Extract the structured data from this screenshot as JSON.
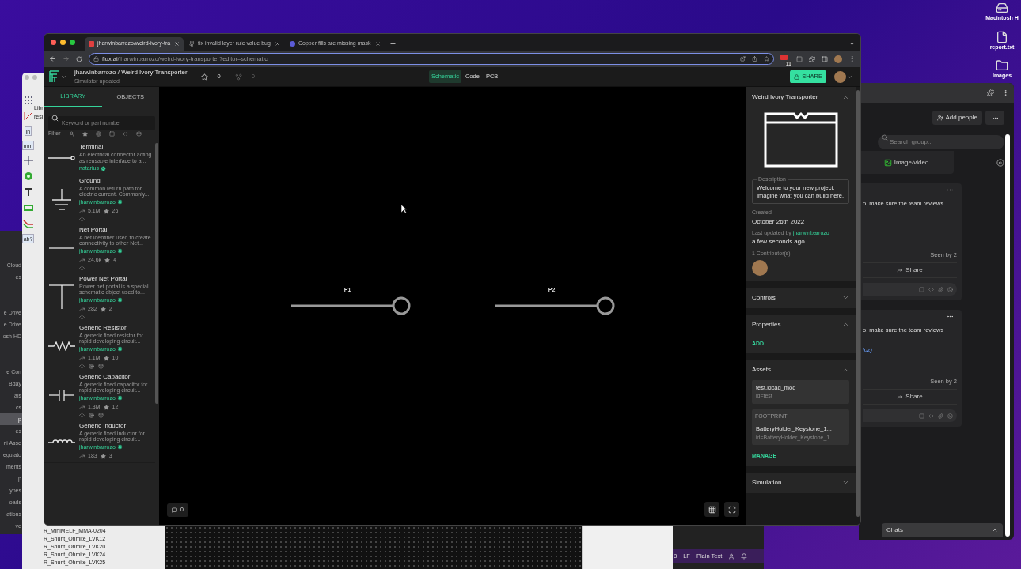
{
  "desktop": {
    "icons": [
      {
        "kind": "drive",
        "label": "Macintosh H"
      },
      {
        "kind": "file",
        "label": "report.txt"
      },
      {
        "kind": "folder",
        "label": "Images"
      }
    ]
  },
  "finder": {
    "groups": [
      [
        {
          "label": "Cloud",
          "selected": false
        },
        {
          "label": "es",
          "selected": false
        }
      ],
      [
        {
          "label": "e Drive",
          "selected": false
        },
        {
          "label": "e Drive",
          "selected": false
        },
        {
          "label": "osh HD",
          "selected": false
        }
      ],
      [
        {
          "label": "e Con",
          "selected": false
        },
        {
          "label": "Bday",
          "selected": false
        },
        {
          "label": "als",
          "selected": false
        },
        {
          "label": "cs",
          "selected": false
        },
        {
          "label": "p",
          "selected": true
        },
        {
          "label": "es",
          "selected": false
        },
        {
          "label": "ni Asse",
          "selected": false
        },
        {
          "label": "egulato",
          "selected": false
        },
        {
          "label": "ments",
          "selected": false
        },
        {
          "label": "p",
          "selected": false
        },
        {
          "label": "ypes",
          "selected": false
        },
        {
          "label": "oads",
          "selected": false
        },
        {
          "label": "ations",
          "selected": false
        },
        {
          "label": "ve",
          "selected": false
        }
      ]
    ]
  },
  "kicad": {
    "tab_fragment": "Libr",
    "search_fragment": "resi",
    "tools": [
      {
        "kind": "grid"
      },
      {
        "kind": "polar"
      },
      {
        "kind": "unit",
        "label": "in"
      },
      {
        "kind": "unit",
        "label": "mm"
      },
      {
        "kind": "cursor"
      },
      {
        "kind": "circle"
      },
      {
        "kind": "text"
      },
      {
        "kind": "chip"
      },
      {
        "kind": "route"
      },
      {
        "kind": "unit",
        "label": "ab?"
      }
    ],
    "footprints": [
      "R_MiniMELF_MMA-0204",
      "R_Shunt_Ohmite_LVK12",
      "R_Shunt_Ohmite_LVK20",
      "R_Shunt_Ohmite_LVK24",
      "R_Shunt_Ohmite_LVK25"
    ]
  },
  "browser": {
    "tabs": [
      {
        "title": "jharwinbarrozo/weird-ivory-tra",
        "selected": true
      },
      {
        "title": "fix invalid layer rule value bug",
        "selected": false
      },
      {
        "title": "Copper fills are missing mask",
        "selected": false
      }
    ],
    "address": {
      "host": "flux.ai",
      "path": "/jharwinbarrozo/weird-ivory-transporter?editor=schematic"
    },
    "extension_badge": "11"
  },
  "app": {
    "title": "jharwinbarrozo / Weird Ivory Transporter",
    "status": "Simulator updated",
    "star_count": "0",
    "fork_count": "0",
    "editor_tabs": [
      {
        "label": "Schematic",
        "selected": true
      },
      {
        "label": "Code",
        "selected": false
      },
      {
        "label": "PCB",
        "selected": false
      }
    ],
    "share": "SHARE"
  },
  "library": {
    "tabs": [
      {
        "label": "LIBRARY",
        "selected": true
      },
      {
        "label": "OBJECTS",
        "selected": false
      }
    ],
    "search": {
      "placeholder": "Keyword or part number"
    },
    "filter_label": "Filter",
    "parts": [
      {
        "kind": "terminal",
        "name": "Terminal",
        "description": "An electrical connector acting as reusable interface to a...",
        "author": "natarius"
      },
      {
        "kind": "ground",
        "name": "Ground",
        "description": "A common return path for electric current. Commonly...",
        "author": "jharwinbarrozo",
        "uses": "5.1M",
        "star_count": "26",
        "simulation": false,
        "model": false
      },
      {
        "kind": "net_portal",
        "name": "Net Portal",
        "description": "A net identifier used to create connectivity to other Net...",
        "author": "jharwinbarrozo",
        "uses": "24.6k",
        "star_count": "4",
        "simulation": false,
        "model": false
      },
      {
        "kind": "power_net_portal",
        "name": "Power Net Portal",
        "description": "Power net portal is a special schematic object used to...",
        "author": "jharwinbarrozo",
        "uses": "282",
        "star_count": "2",
        "simulation": false,
        "model": false
      },
      {
        "kind": "resistor",
        "name": "Generic Resistor",
        "description": "A generic fixed resistor for rapid developing circuit...",
        "author": "jharwinbarrozo",
        "uses": "1.1M",
        "star_count": "10",
        "simulation": true,
        "model": true
      },
      {
        "kind": "capacitor",
        "name": "Generic Capacitor",
        "description": "A generic fixed capacitor for rapid developing circuit...",
        "author": "jharwinbarrozo",
        "uses": "1.3M",
        "star_count": "12",
        "simulation": true,
        "model": true
      },
      {
        "kind": "inductor",
        "name": "Generic Inductor",
        "description": "A generic fixed inductor for rapid developing circuit...",
        "author": "jharwinbarrozo",
        "uses": "183",
        "star_count": "3"
      }
    ]
  },
  "canvas": {
    "ports": [
      {
        "label": "P1"
      },
      {
        "label": "P2"
      }
    ],
    "comment_count": "0"
  },
  "inspector": {
    "project": {
      "title": "Weird Ivory Transporter",
      "expanded": true,
      "description_label": "Description",
      "description": "Welcome to your new project. Imagine what you can build here.",
      "created_label": "Created",
      "created": "October 26th 2022",
      "updated_label": "Last updated by",
      "updated_by": "jharwinbarrozo",
      "updated": "a few seconds ago",
      "contributors_label": "1 Contributor(s)"
    },
    "controls": {
      "title": "Controls",
      "expanded": false
    },
    "properties": {
      "title": "Properties",
      "expanded": true,
      "action": "ADD"
    },
    "assets": {
      "title": "Assets",
      "expanded": true,
      "items": [
        {
          "name": "test.kicad_mod",
          "id": "id=test"
        },
        {
          "tag": "FOOTPRINT",
          "name": "BatteryHolder_Keystone_1...",
          "id": "id=BatteryHolder_Keystone_1..."
        }
      ],
      "action": "MANAGE"
    },
    "simulation": {
      "title": "Simulation",
      "expanded": false
    }
  },
  "chat": {
    "add_people": "Add people",
    "search": {
      "placeholder": "Search group..."
    },
    "media_button": "Image/video",
    "messages": [
      {
        "text": "o, make sure the team reviews",
        "seen": "Seen by 2",
        "share": "Share"
      },
      {
        "text": "o, make sure the team reviews",
        "link": "ioz)",
        "seen": "Seen by 2",
        "share": "Share"
      }
    ],
    "chats_label": "Chats"
  },
  "editor_status": [
    "8",
    "LF",
    "Plain Text"
  ]
}
